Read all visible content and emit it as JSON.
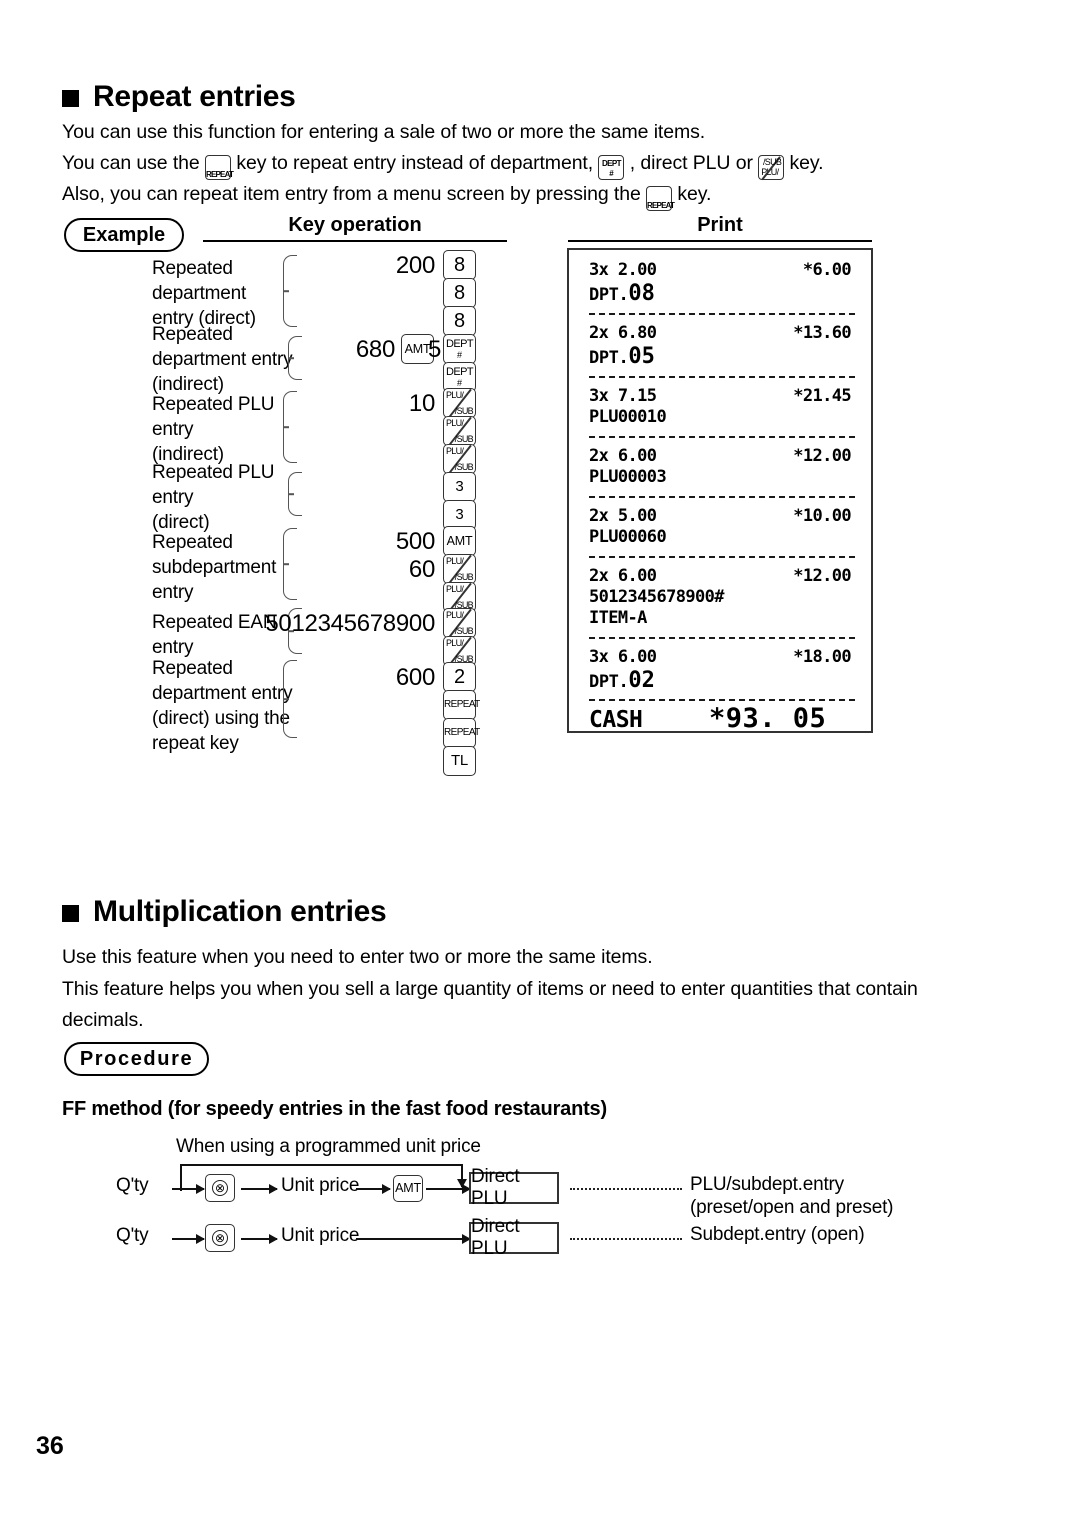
{
  "page": {
    "number": "36"
  },
  "sections": {
    "repeat": {
      "title": "Repeat entries",
      "line1": "You can use this function for entering a sale of two or more the same items.",
      "line2_a": "You can use the",
      "line2_b": "key to repeat entry instead of department,",
      "line2_c": ", direct PLU or",
      "line2_d": "key.",
      "line3_a": "Also, you can repeat item entry from a menu screen by pressing the",
      "line3_b": "key."
    },
    "multiplication": {
      "title": "Multiplication entries",
      "line1": "Use this feature when you need to enter two or more the same items.",
      "line2": "This feature helps you when you sell a large quantity of items or need to enter quantities that contain decimals."
    }
  },
  "badges": {
    "example": "Example",
    "procedure": "Procedure"
  },
  "columns": {
    "key_operation": "Key operation",
    "print": "Print"
  },
  "example_rows": [
    {
      "label": "Repeated\ndepartment\nentry (direct)",
      "label_lines": [
        "Repeated",
        "department",
        "entry (direct)"
      ]
    },
    {
      "label_lines": [
        "Repeated",
        "department entry",
        "(indirect)"
      ]
    },
    {
      "label_lines": [
        "Repeated PLU",
        "entry",
        "(indirect)"
      ]
    },
    {
      "label_lines": [
        "Repeated PLU",
        "entry",
        "(direct)"
      ]
    },
    {
      "label_lines": [
        "Repeated",
        "subdepartment",
        "entry"
      ]
    },
    {
      "label_lines": [
        "Repeated EAN",
        "entry"
      ]
    },
    {
      "label_lines": [
        "Repeated",
        "department entry",
        "(direct) using the",
        "repeat key"
      ]
    }
  ],
  "key_sequence": [
    {
      "num": "200",
      "key": "8",
      "key_type": "digit"
    },
    {
      "num": "",
      "key": "8",
      "key_type": "digit"
    },
    {
      "num": "",
      "key": "8",
      "key_type": "digit"
    },
    {
      "num": "680",
      "mid_key": "AMT",
      "num2": "5",
      "key": "DEPT#",
      "key_type": "dept"
    },
    {
      "num": "",
      "key": "DEPT#",
      "key_type": "dept"
    },
    {
      "num": "10",
      "key": "PLU/SUB",
      "key_type": "plusub"
    },
    {
      "num": "",
      "key": "PLU/SUB",
      "key_type": "plusub"
    },
    {
      "num": "",
      "key": "PLU/SUB",
      "key_type": "plusub"
    },
    {
      "num": "",
      "key": "3",
      "key_type": "digit"
    },
    {
      "num": "",
      "key": "3",
      "key_type": "digit"
    },
    {
      "num": "500",
      "key": "AMT",
      "key_type": "amt"
    },
    {
      "num": "60",
      "key": "PLU/SUB",
      "key_type": "plusub"
    },
    {
      "num": "",
      "key": "PLU/SUB",
      "key_type": "plusub"
    },
    {
      "num": "5012345678900",
      "key": "PLU/SUB",
      "key_type": "plusub"
    },
    {
      "num": "",
      "key": "PLU/SUB",
      "key_type": "plusub"
    },
    {
      "num": "600",
      "key": "2",
      "key_type": "digit"
    },
    {
      "num": "",
      "key": "REPEAT",
      "key_type": "repeat"
    },
    {
      "num": "",
      "key": "REPEAT",
      "key_type": "repeat"
    },
    {
      "num": "",
      "key": "TL",
      "key_type": "tl"
    }
  ],
  "key_labels": {
    "dept_top": "DEPT",
    "dept_bot": "#",
    "plu_top": "PLU/",
    "plu_bot": "/SUB",
    "amt": "AMT",
    "repeat": "REPEAT",
    "tl": "TL",
    "multiply": "⊗"
  },
  "receipt": {
    "entries": [
      {
        "qty": "3x 2.00",
        "amount": "*6.00",
        "item_prefix": "DPT.",
        "item_big": "08"
      },
      {
        "qty": "2x 6.80",
        "amount": "*13.60",
        "item_prefix": "DPT.",
        "item_big": "05"
      },
      {
        "qty": "3x 7.15",
        "amount": "*21.45",
        "item": "PLU00010"
      },
      {
        "qty": "2x 6.00",
        "amount": "*12.00",
        "item": "PLU00003"
      },
      {
        "qty": "2x 5.00",
        "amount": "*10.00",
        "item": "PLU00060"
      },
      {
        "qty": "2x 6.00",
        "amount": "*12.00",
        "item": "5012345678900#",
        "item2": "ITEM-A"
      },
      {
        "qty": "3x 6.00",
        "amount": "*18.00",
        "item_prefix": "DPT.",
        "item_big": "02"
      }
    ],
    "total_label": "CASH",
    "total_amount": "*93. 05"
  },
  "flow": {
    "heading": "FF method (for speedy entries in the fast food restaurants)",
    "note": "When using a programmed unit price",
    "qty": "Q'ty",
    "unit_price": "Unit price",
    "direct_plu": "Direct PLU",
    "amt": "AMT",
    "result1_line1": "PLU/subdept.entry",
    "result1_line2": "(preset/open and preset)",
    "result2": "Subdept.entry (open)"
  }
}
